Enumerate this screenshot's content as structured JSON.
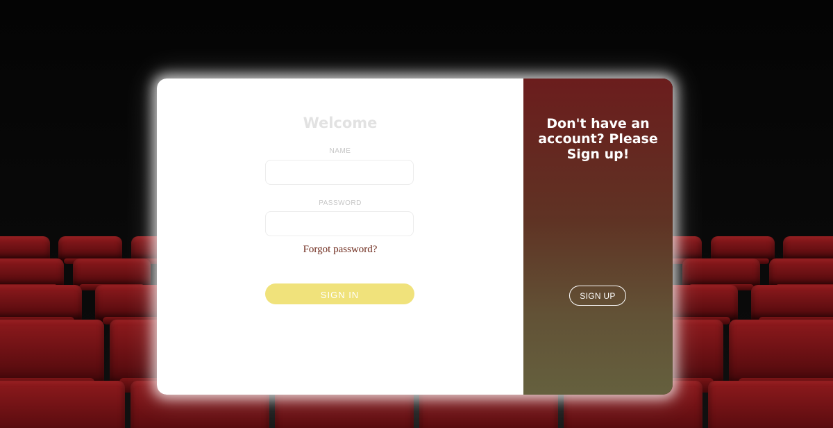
{
  "login": {
    "title": "Welcome",
    "name_label": "NAME",
    "name_value": "",
    "password_label": "PASSWORD",
    "password_value": "",
    "forgot_password": "Forgot password?",
    "signin_label": "SIGN IN"
  },
  "signup": {
    "title": "Don't have an account? Please Sign up!",
    "button_label": "SIGN UP"
  },
  "colors": {
    "signin_button": "#f0e27b",
    "signup_panel_top": "#6b1d1d",
    "signup_panel_bottom": "#65603e",
    "forgot_link": "#6e2a1c",
    "seat_red": "#8e1a1d"
  }
}
